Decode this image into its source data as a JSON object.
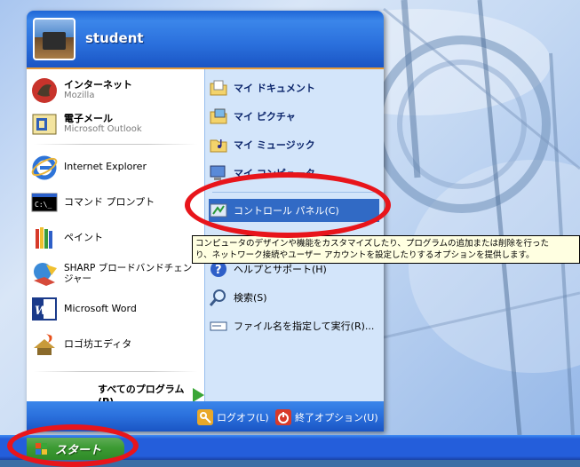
{
  "user": {
    "name": "student"
  },
  "left_items": [
    {
      "main": "インターネット",
      "sub": "Mozilla",
      "bold": true,
      "icon": "mozilla-icon"
    },
    {
      "main": "電子メール",
      "sub": "Microsoft Outlook",
      "bold": true,
      "icon": "outlook-icon"
    },
    {
      "main": "Internet Explorer",
      "sub": "",
      "bold": false,
      "icon": "internet-explorer-icon"
    },
    {
      "main": "コマンド プロンプト",
      "sub": "",
      "bold": false,
      "icon": "command-prompt-icon"
    },
    {
      "main": "ペイント",
      "sub": "",
      "bold": false,
      "icon": "paint-icon"
    },
    {
      "main": "SHARP ブロードバンドチェンジャー",
      "sub": "",
      "bold": false,
      "icon": "sharp-broadband-icon"
    },
    {
      "main": "Microsoft Word",
      "sub": "",
      "bold": false,
      "icon": "word-icon"
    },
    {
      "main": "ロゴ坊エディタ",
      "sub": "",
      "bold": false,
      "icon": "logo-editor-icon"
    }
  ],
  "all_programs": "すべてのプログラム(P)",
  "right_items": [
    {
      "label": "マイ ドキュメント",
      "icon": "folder-icon"
    },
    {
      "label": "マイ ピクチャ",
      "icon": "pictures-folder-icon"
    },
    {
      "label": "マイ ミュージック",
      "icon": "music-folder-icon"
    },
    {
      "label": "マイ コンピュータ",
      "icon": "computer-icon"
    },
    {
      "label": "コントロール パネル(C)",
      "icon": "control-panel-icon"
    },
    {
      "label": "ヘルプとサポート(H)",
      "icon": "help-icon"
    },
    {
      "label": "検索(S)",
      "icon": "search-icon"
    },
    {
      "label": "ファイル名を指定して実行(R)...",
      "icon": "run-icon"
    }
  ],
  "tooltip": {
    "line1": "コンピュータのデザインや機能をカスタマイズしたり、プログラムの追加または削除を行った",
    "line2": "り、ネットワーク接続やユーザー アカウントを設定したりするオプションを提供します。"
  },
  "footer": {
    "logoff": "ログオフ(L)",
    "shutdown": "終了オプション(U)"
  },
  "taskbar": {
    "start_label": "スタート"
  },
  "colors": {
    "highlight": "#316ac5",
    "annotation": "#e8151b",
    "start_green": "#3c9b33"
  }
}
